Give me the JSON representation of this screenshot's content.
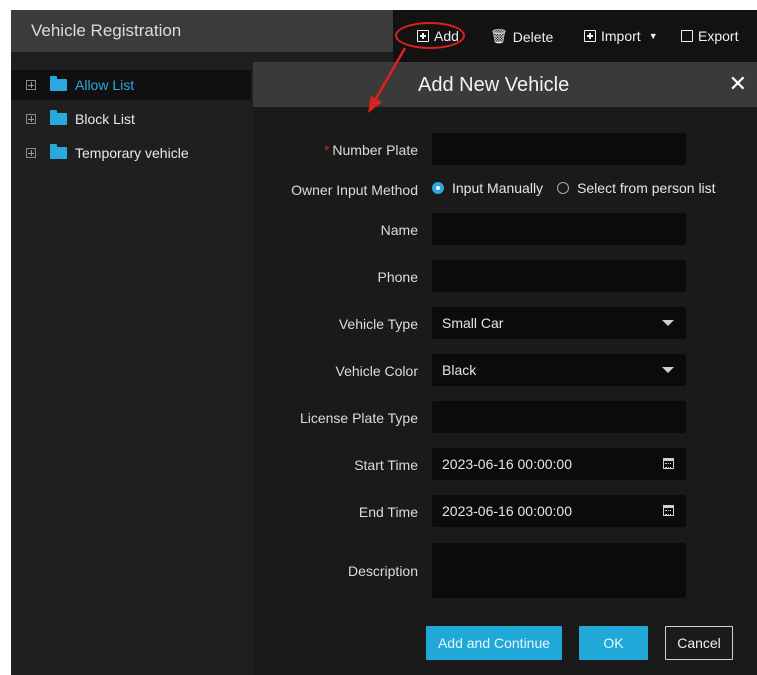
{
  "title": "Vehicle Registration",
  "toolbar": {
    "add": "Add",
    "delete": "Delete",
    "import": "Import",
    "export": "Export"
  },
  "tree": [
    {
      "label": "Allow List",
      "selected": true
    },
    {
      "label": "Block List",
      "selected": false
    },
    {
      "label": "Temporary vehicle",
      "selected": false
    }
  ],
  "dialog": {
    "title": "Add New Vehicle",
    "close": "✕",
    "fields": {
      "number_plate": {
        "label": "Number Plate",
        "required": true,
        "value": ""
      },
      "owner_input_method": {
        "label": "Owner Input Method",
        "options": [
          "Input Manually",
          "Select from person list"
        ],
        "selected": "Input Manually"
      },
      "name": {
        "label": "Name",
        "value": ""
      },
      "phone": {
        "label": "Phone",
        "value": ""
      },
      "vehicle_type": {
        "label": "Vehicle Type",
        "value": "Small Car"
      },
      "vehicle_color": {
        "label": "Vehicle Color",
        "value": "Black"
      },
      "license_plate_type": {
        "label": "License Plate Type",
        "value": ""
      },
      "start_time": {
        "label": "Start Time",
        "value": "2023-06-16 00:00:00"
      },
      "end_time": {
        "label": "End Time",
        "value": "2023-06-16 00:00:00"
      },
      "description": {
        "label": "Description",
        "value": ""
      }
    },
    "buttons": {
      "add_continue": "Add and Continue",
      "ok": "OK",
      "cancel": "Cancel"
    }
  },
  "colors": {
    "accent": "#20a9d8",
    "annotation": "#e0201e",
    "background": "#1e1e1e"
  }
}
